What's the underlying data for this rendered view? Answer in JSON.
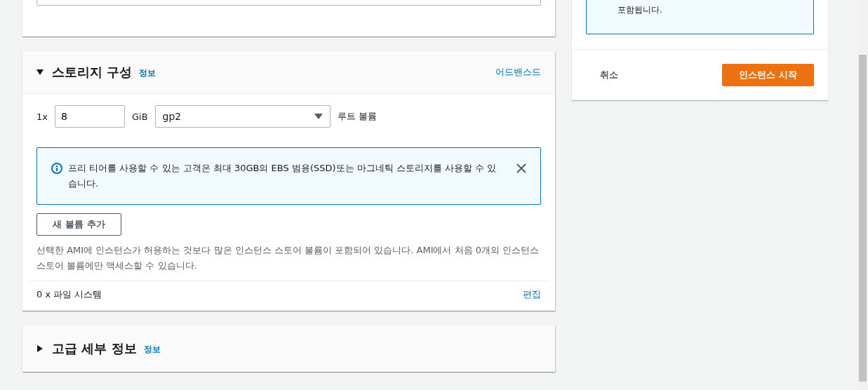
{
  "side_panel": {
    "notice_text": "포함됩니다.",
    "cancel": "취소",
    "launch": "인스턴스 시작"
  },
  "sections": [
    {
      "title": "스토리지 구성",
      "info": "정보",
      "expanded": true,
      "advanced": "어드밴스드",
      "volume": {
        "count": "1x",
        "size": "8",
        "unit": "GiB",
        "type": "gp2",
        "label": "루트 볼륨"
      },
      "alert": "프리 티어를 사용할 수 있는 고객은 최대 30GB의 EBS 범용(SSD)또는 마그네틱 스토리지를 사용할 수 있습니다.",
      "add_button": "새 볼륨 추가",
      "note": "선택한 AMI에 인스턴스가 허용하는 것보다 많은 인스턴스 스토어 볼륨이 포함되어 있습니다. AMI에서 처음 0개의 인스턴스 스토어 볼륨에만 액세스할 수 있습니다.",
      "filesystems": "0 x 파일 시스템",
      "edit": "편집"
    },
    {
      "title": "고급 세부 정보",
      "info": "정보",
      "expanded": false
    }
  ]
}
